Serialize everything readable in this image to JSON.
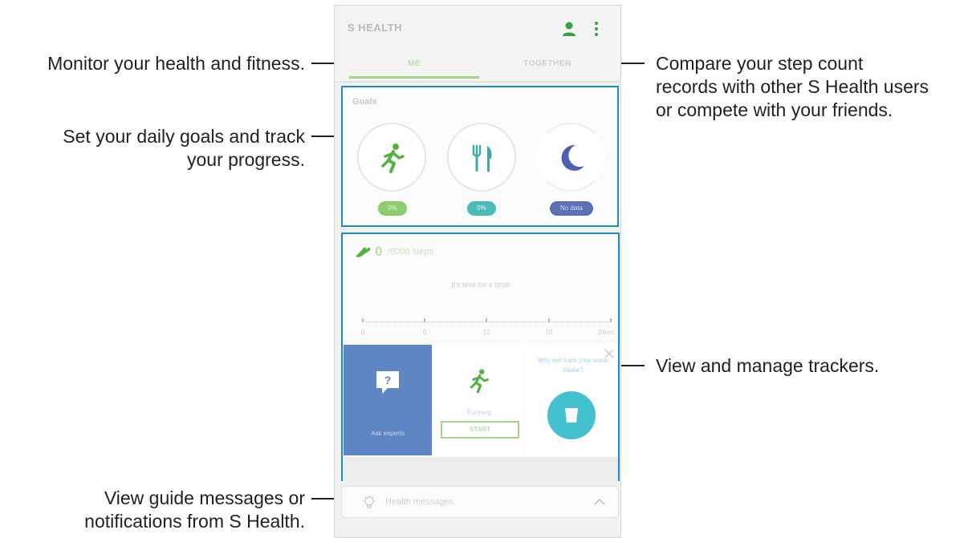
{
  "annotations": {
    "monitor": "Monitor your health and fitness.",
    "goals_line1": "Set your daily goals and track",
    "goals_line2": "your progress.",
    "guide_line1": "View guide messages or",
    "guide_line2": "notifications from S Health.",
    "compare_line1": "Compare your step count",
    "compare_line2": "records with other S Health users",
    "compare_line3": "or compete with your friends.",
    "trackers": "View and manage trackers."
  },
  "app": {
    "title": "S HEALTH",
    "icons": [
      "profile-icon",
      "more-options-icon"
    ]
  },
  "tabs": [
    {
      "label": "ME",
      "selected": true
    },
    {
      "label": "TOGETHER",
      "selected": false
    }
  ],
  "goals": {
    "title": "Goals",
    "items": [
      {
        "icon": "running-icon",
        "badge": "0%",
        "color": "#8fcb6f"
      },
      {
        "icon": "fork-knife-icon",
        "badge": "0%",
        "color": "#4cbab8"
      },
      {
        "icon": "moon-icon",
        "badge": "No data",
        "color": "#5b6fb8"
      }
    ]
  },
  "steps": {
    "icon": "shoe-icon",
    "count": "0",
    "goal": "/6000 steps",
    "message": "It's time for a stroll",
    "axis_labels": [
      "0",
      "6",
      "12",
      "18",
      "24hrs"
    ]
  },
  "trackers": {
    "ask_experts": {
      "icon": "question-bubble-icon",
      "label": "Ask experts"
    },
    "running": {
      "icon": "running-icon",
      "label": "Running",
      "button": "START"
    },
    "water": {
      "text": "Why not track your water intake?",
      "icon": "cup-icon"
    }
  },
  "health_messages": {
    "icon": "lightbulb-icon",
    "label": "Health messages",
    "chevron": "chevron-up-icon"
  },
  "colors": {
    "accent_green": "#8fcb6f",
    "highlight_blue": "#1b8bc5",
    "teal": "#4cbab8",
    "indigo": "#5b6fb8"
  }
}
